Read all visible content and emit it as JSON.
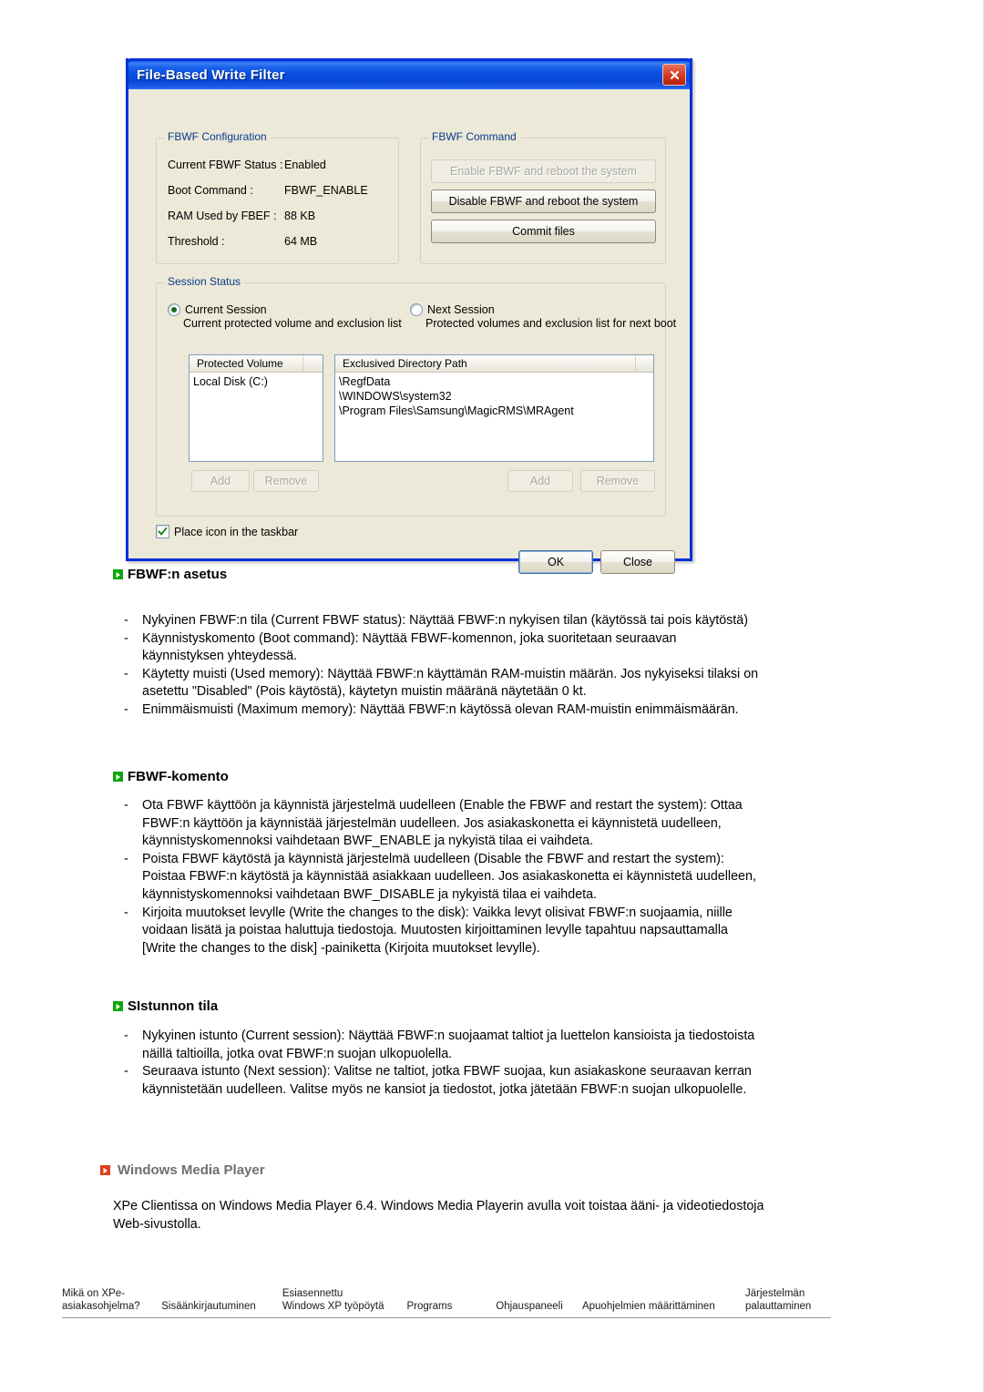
{
  "dialog": {
    "title": "File-Based Write Filter",
    "close_icon": "close-icon",
    "config_group": {
      "title": "FBWF Configuration",
      "rows": [
        {
          "label": "Current FBWF Status :",
          "value": "Enabled"
        },
        {
          "label": "Boot Command :",
          "value": "FBWF_ENABLE"
        },
        {
          "label": "RAM Used by FBEF :",
          "value": "88 KB"
        },
        {
          "label": "Threshold :",
          "value": "64 MB"
        }
      ]
    },
    "command_group": {
      "title": "FBWF Command",
      "buttons": [
        {
          "label": "Enable FBWF and reboot the system",
          "enabled": false
        },
        {
          "label": "Disable FBWF and reboot the system",
          "enabled": true
        },
        {
          "label": "Commit files",
          "enabled": true
        }
      ]
    },
    "session_group": {
      "title": "Session Status",
      "current_session": {
        "label": "Current Session",
        "sub": "Current  protected volume and exclusion list",
        "selected": true
      },
      "next_session": {
        "label": "Next Session",
        "sub": "Protected volumes and exclusion list for next boot",
        "selected": false
      },
      "volume_list": {
        "header": "Protected Volume",
        "items": [
          "Local Disk (C:)"
        ]
      },
      "path_list": {
        "header": "Exclusived Directory Path",
        "items": [
          "\\RegfData",
          "\\WINDOWS\\system32",
          "\\Program Files\\Samsung\\MagicRMS\\MRAgent"
        ]
      },
      "volume_add": "Add",
      "volume_remove": "Remove",
      "path_add": "Add",
      "path_remove": "Remove"
    },
    "taskbar_checkbox": {
      "label": "Place icon in the taskbar",
      "checked": true
    },
    "ok_label": "OK",
    "close_label": "Close"
  },
  "sections": [
    {
      "heading": "FBWF:n asetus",
      "items": [
        "Nykyinen FBWF:n tila (Current FBWF status): Näyttää FBWF:n nykyisen tilan (käytössä tai pois käytöstä)",
        "Käynnistyskomento (Boot command): Näyttää FBWF-komennon, joka suoritetaan seuraavan käynnistyksen yhteydessä.",
        "Käytetty muisti (Used memory): Näyttää FBWF:n käyttämän RAM-muistin määrän. Jos nykyiseksi tilaksi on asetettu \"Disabled\" (Pois käytöstä), käytetyn muistin määränä näytetään 0 kt.",
        "Enimmäismuisti (Maximum memory): Näyttää FBWF:n käytössä olevan RAM-muistin enimmäismäärän."
      ]
    },
    {
      "heading": "FBWF-komento",
      "items": [
        "Ota FBWF käyttöön ja käynnistä järjestelmä uudelleen (Enable the FBWF and restart the system): Ottaa FBWF:n käyttöön ja käynnistää järjestelmän uudelleen. Jos asiakaskonetta ei käynnistetä uudelleen, käynnistyskomennoksi vaihdetaan BWF_ENABLE ja nykyistä tilaa ei vaihdeta.",
        "Poista FBWF käytöstä ja käynnistä järjestelmä uudelleen (Disable the FBWF and restart the system): Poistaa FBWF:n käytöstä ja käynnistää asiakkaan uudelleen. Jos asiakaskonetta ei käynnistetä uudelleen, käynnistyskomennoksi vaihdetaan BWF_DISABLE ja nykyistä tilaa ei vaihdeta.",
        "Kirjoita muutokset levylle (Write the changes to the disk): Vaikka levyt olisivat FBWF:n suojaamia, niille voidaan lisätä ja poistaa haluttuja tiedostoja. Muutosten kirjoittaminen levylle tapahtuu napsauttamalla [Write the changes to the disk] -painiketta (Kirjoita muutokset levylle)."
      ]
    },
    {
      "heading": "SIstunnon tila",
      "items": [
        "Nykyinen istunto (Current session): Näyttää FBWF:n suojaamat taltiot ja luettelon kansioista ja tiedostoista näillä taltioilla, jotka ovat FBWF:n suojan ulkopuolella.",
        "Seuraava istunto (Next session): Valitse ne taltiot, jotka FBWF suojaa, kun asiakaskone seuraavan kerran käynnistetään uudelleen. Valitse myös ne kansiot ja tiedostot, jotka jätetään FBWF:n suojan ulkopuolelle."
      ]
    }
  ],
  "wmp": {
    "heading": "Windows Media Player",
    "paragraph": "XPe Clientissa on Windows Media Player 6.4. Windows Media Playerin avulla voit toistaa ääni- ja videotiedostoja Web-sivustolla."
  },
  "footer_nav": [
    "Mikä on XPe-\nasiakasohjelma?",
    "Sisäänkirjautuminen",
    "Esiasennettu\nWindows XP työpöytä",
    "Programs",
    "Ohjauspaneeli",
    "Apuohjelmien määrittäminen",
    "Järjestelmän\npalauttaminen"
  ],
  "colors": {
    "titlebar_blue": "#0831d9",
    "dialog_face": "#ece9d8",
    "group_label_blue": "#0b3a8f",
    "bullet_green": "#0aa60a",
    "bullet_red": "#e03c20",
    "wmp_heading_gray": "#6f6f6f"
  }
}
